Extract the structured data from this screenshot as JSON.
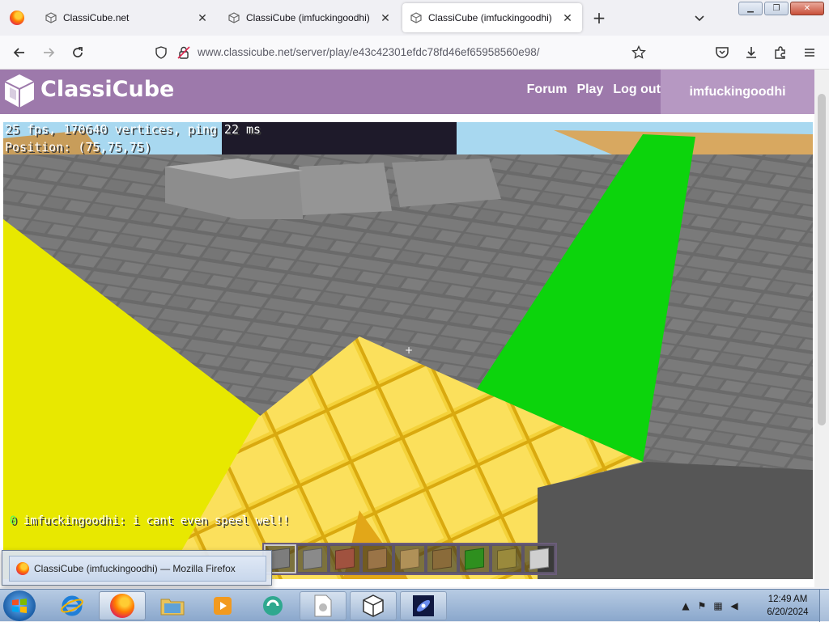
{
  "browser": {
    "tabs": [
      {
        "title": "ClassiCube.net",
        "active": false
      },
      {
        "title": "ClassiCube (imfuckingoodhi)",
        "active": false
      },
      {
        "title": "ClassiCube (imfuckingoodhi)",
        "active": true
      }
    ],
    "url": "www.classicube.net/server/play/e43c42301efdc78fd46ef65958560e98/"
  },
  "site": {
    "logo_text": "ClassiCube",
    "nav": {
      "forum": "Forum",
      "play": "Play",
      "logout": "Log out"
    },
    "username": "imfuckingoodhi"
  },
  "game": {
    "stats": "25 fps, 170640 vertices, ping 22 ms",
    "position": "Position: (75,75,75)",
    "chat": {
      "count": "0",
      "message": "imfuckingoodhi: i cant even speel wel!!"
    },
    "crosshair": "+",
    "hotbar": [
      {
        "name": "stone",
        "color": "#7d7d7d"
      },
      {
        "name": "cobblestone",
        "color": "#8a8a8a"
      },
      {
        "name": "brick",
        "color": "#a0523f"
      },
      {
        "name": "wood-planks",
        "color": "#9a7447"
      },
      {
        "name": "log",
        "color": "#b09158"
      },
      {
        "name": "bookshelf",
        "color": "#8a6b3a"
      },
      {
        "name": "leaves",
        "color": "#2e8f1e"
      },
      {
        "name": "wood-crate",
        "color": "#9a8a3c"
      },
      {
        "name": "slab",
        "color": "#cfcfcf"
      }
    ],
    "selected_slot": 0
  },
  "tooltip": {
    "text": "ClassiCube (imfuckingoodhi) — Mozilla Firefox"
  },
  "taskbar": {
    "time": "12:49 AM",
    "date": "6/20/2024"
  }
}
